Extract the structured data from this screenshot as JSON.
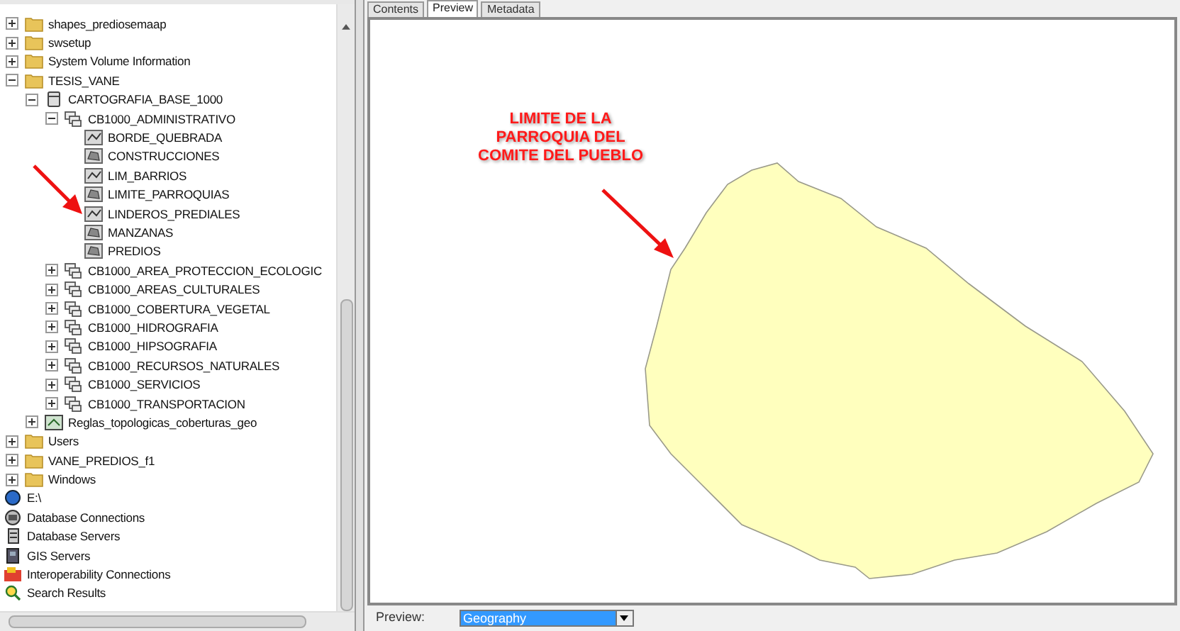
{
  "tree": {
    "nested_items": [
      {
        "label": "shapes_prediosemaap",
        "kind": "folder",
        "expanded": false
      },
      {
        "label": "swsetup",
        "kind": "folder",
        "expanded": false
      },
      {
        "label": "System Volume Information",
        "kind": "folder",
        "expanded": false
      },
      {
        "label": "TESIS_VANE",
        "kind": "folder",
        "expanded": true,
        "children": [
          {
            "label": "CARTOGRAFIA_BASE_1000",
            "kind": "geodatabase",
            "expanded": true,
            "children": [
              {
                "label": "CB1000_ADMINISTRATIVO",
                "kind": "dataset",
                "expanded": true,
                "children": [
                  {
                    "label": "BORDE_QUEBRADA",
                    "kind": "line_class"
                  },
                  {
                    "label": "CONSTRUCCIONES",
                    "kind": "polygon_class"
                  },
                  {
                    "label": "LIM_BARRIOS",
                    "kind": "line_class"
                  },
                  {
                    "label": "LIMITE_PARROQUIAS",
                    "kind": "polygon_class"
                  },
                  {
                    "label": "LINDEROS_PREDIALES",
                    "kind": "line_class"
                  },
                  {
                    "label": "MANZANAS",
                    "kind": "polygon_class"
                  },
                  {
                    "label": "PREDIOS",
                    "kind": "polygon_class"
                  }
                ]
              },
              {
                "label": "CB1000_AREA_PROTECCION_ECOLOGIC",
                "kind": "dataset",
                "expanded": false
              },
              {
                "label": "CB1000_AREAS_CULTURALES",
                "kind": "dataset",
                "expanded": false
              },
              {
                "label": "CB1000_COBERTURA_VEGETAL",
                "kind": "dataset",
                "expanded": false
              },
              {
                "label": "CB1000_HIDROGRAFIA",
                "kind": "dataset",
                "expanded": false
              },
              {
                "label": "CB1000_HIPSOGRAFIA",
                "kind": "dataset",
                "expanded": false
              },
              {
                "label": "CB1000_RECURSOS_NATURALES",
                "kind": "dataset",
                "expanded": false
              },
              {
                "label": "CB1000_SERVICIOS",
                "kind": "dataset",
                "expanded": false
              },
              {
                "label": "CB1000_TRANSPORTACION",
                "kind": "dataset",
                "expanded": false
              }
            ]
          },
          {
            "label": "Reglas_topologicas_coberturas_geo",
            "kind": "topology",
            "expanded": false
          }
        ]
      },
      {
        "label": "Users",
        "kind": "folder",
        "expanded": false
      },
      {
        "label": "VANE_PREDIOS_f1",
        "kind": "folder",
        "expanded": false
      },
      {
        "label": "Windows",
        "kind": "folder",
        "expanded": false
      }
    ],
    "items": [
      {
        "label": "E:\\",
        "kind": "drive"
      },
      {
        "label": "Database Connections",
        "kind": "db_connections"
      },
      {
        "label": "Database Servers",
        "kind": "db_servers"
      },
      {
        "label": "GIS Servers",
        "kind": "gis_servers"
      },
      {
        "label": "Interoperability Connections",
        "kind": "interop"
      },
      {
        "label": "Search Results",
        "kind": "search"
      }
    ]
  },
  "tabs": [
    {
      "label": "Contents",
      "selected": false
    },
    {
      "label": "Preview",
      "selected": true
    },
    {
      "label": "Metadata",
      "selected": false
    }
  ],
  "annotation": {
    "lines": [
      "LIMITE DE LA",
      "PARROQUIA DEL",
      "COMITE DEL PUEBLO"
    ]
  },
  "preview_bar": {
    "label": "Preview:",
    "value": "Geography"
  }
}
